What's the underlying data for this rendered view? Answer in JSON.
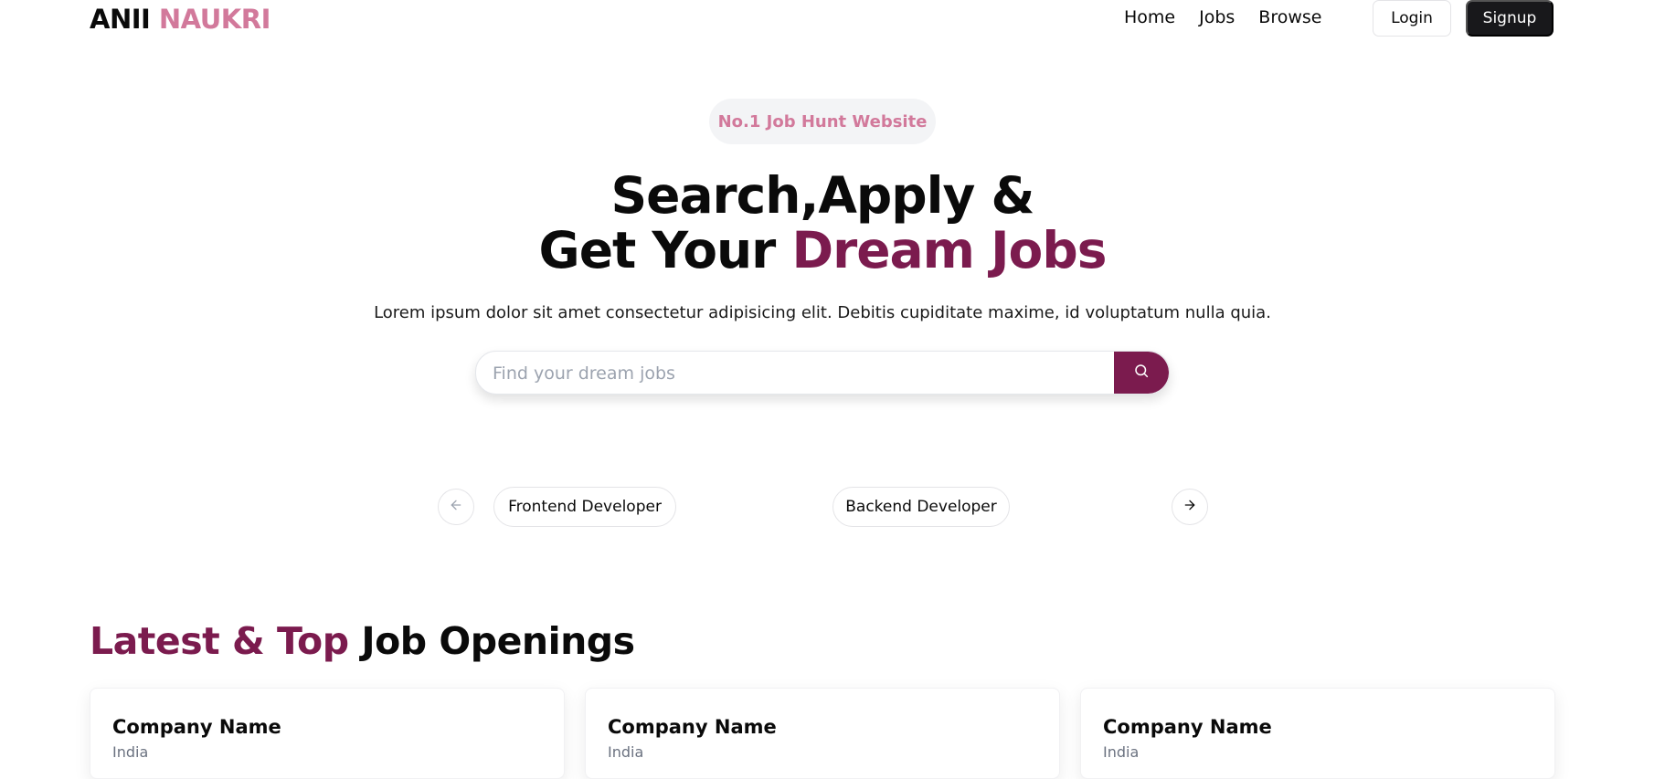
{
  "navbar": {
    "logo_part1": "ANII",
    "logo_part2": "NAUKRI",
    "links": [
      "Home",
      "Jobs",
      "Browse"
    ],
    "login_label": "Login",
    "signup_label": "Signup"
  },
  "hero": {
    "badge": "No.1 Job Hunt Website",
    "title_line1": "Search,Apply &",
    "title_line2_prefix": "Get Your ",
    "title_line2_accent": "Dream Jobs",
    "description": "Lorem ipsum dolor sit amet consectetur adipisicing elit. Debitis cupiditate maxime, id voluptatum nulla quia.",
    "search": {
      "placeholder": "Find your dream jobs",
      "value": "",
      "button_icon": "search-icon"
    }
  },
  "carousel": {
    "prev_icon": "arrow-left-icon",
    "next_icon": "arrow-right-icon",
    "items": [
      "Frontend Developer",
      "Backend Developer"
    ]
  },
  "jobs_section": {
    "title_accent": "Latest & Top",
    "title_rest": " Job Openings",
    "cards": [
      {
        "company": "Company Name",
        "location": "India"
      },
      {
        "company": "Company Name",
        "location": "India"
      },
      {
        "company": "Company Name",
        "location": "India"
      }
    ]
  },
  "colors": {
    "accent": "#7b1b4e",
    "logo_accent": "#d2799b",
    "dark_button": "#18181b",
    "badge_bg": "#f3f4f6"
  }
}
